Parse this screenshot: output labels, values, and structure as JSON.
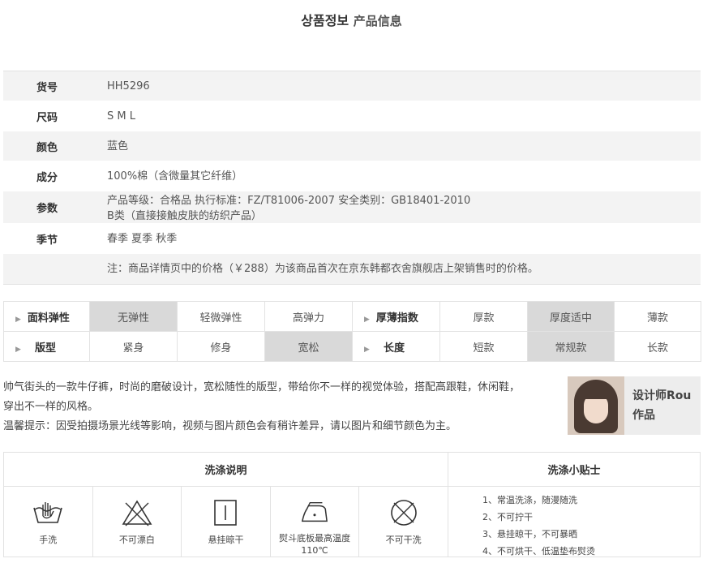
{
  "header": {
    "title_main": "상품정보",
    "title_sub": "产品信息"
  },
  "info": {
    "rows": [
      {
        "label": "货号",
        "value": "HH5296"
      },
      {
        "label": "尺码",
        "value": "S M L"
      },
      {
        "label": "颜色",
        "value": "蓝色"
      },
      {
        "label": "成分",
        "value": "100%棉（含微量其它纤维）"
      },
      {
        "label": "参数",
        "value_line1": "产品等级：合格品   执行标准：FZ/T81006-2007   安全类别：GB18401-2010",
        "value_line2": "B类（直接接触皮肤的纺织产品）"
      },
      {
        "label": "季节",
        "value": "春季 夏季 秋季"
      },
      {
        "label": "",
        "value": "注：商品详情页中的价格（￥288）为该商品首次在京东韩都衣舍旗舰店上架销售时的价格。"
      }
    ]
  },
  "attributes": {
    "row1": {
      "left_head": "面料弹性",
      "left_opts": [
        "无弹性",
        "轻微弹性",
        "高弹力"
      ],
      "left_selected": 0,
      "right_head": "厚薄指数",
      "right_opts": [
        "厚款",
        "厚度适中",
        "薄款"
      ],
      "right_selected": 1
    },
    "row2": {
      "left_head": "版型",
      "left_opts": [
        "紧身",
        "修身",
        "宽松"
      ],
      "left_selected": 2,
      "right_head": "长度",
      "right_opts": [
        "短款",
        "常规款",
        "长款"
      ],
      "right_selected": 1
    }
  },
  "description": {
    "line1": "帅气街头的一款牛仔裤，时尚的磨破设计，宽松随性的版型，带给你不一样的视觉体验，搭配高跟鞋，休闲鞋，",
    "line2": "穿出不一样的风格。",
    "line3": "温馨提示：因受拍摄场景光线等影响，视频与图片颜色会有稍许差异，请以图片和细节颜色为主。"
  },
  "designer": {
    "line1": "设计师Rou",
    "line2": "作品"
  },
  "wash": {
    "title": "洗涤说明",
    "tips_title": "洗涤小贴士",
    "icons": [
      {
        "icon": "hand-wash-icon",
        "caption": "手洗"
      },
      {
        "icon": "no-bleach-icon",
        "caption": "不可漂白"
      },
      {
        "icon": "hang-dry-icon",
        "caption": "悬挂晾干"
      },
      {
        "icon": "iron-icon",
        "caption": "熨斗底板最高温度110℃"
      },
      {
        "icon": "no-tumble-dry-icon",
        "caption": "不可干洗"
      }
    ],
    "tips": [
      "1、常温洗涤，随漫随洗",
      "2、不可拧干",
      "3、悬挂晾干，不可暴晒",
      "4、不可烘干、低温垫布熨烫"
    ]
  }
}
